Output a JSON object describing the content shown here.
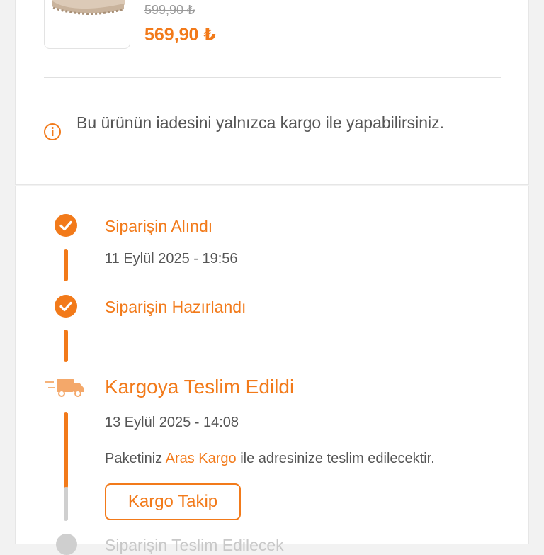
{
  "product": {
    "old_price": "599,90 ₺",
    "new_price": "569,90 ₺"
  },
  "return_notice": {
    "icon": "info-icon",
    "text": "Bu ürünün iadesini yalnızca kargo ile yapabilirsiniz."
  },
  "timeline": {
    "steps": [
      {
        "title": "Siparişin Alındı",
        "date": "11 Eylül 2025 - 19:56",
        "status": "done",
        "icon": "check-circle-icon"
      },
      {
        "title": "Siparişin Hazırlandı",
        "date": "",
        "status": "done",
        "icon": "check-circle-icon"
      },
      {
        "title": "Kargoya Teslim Edildi",
        "date": "13 Eylül 2025 - 14:08",
        "status": "current",
        "icon": "delivery-truck-icon"
      },
      {
        "title": "Siparişin Teslim Edilecek",
        "date": "",
        "status": "pending",
        "icon": "pending-circle-icon"
      }
    ],
    "note_prefix": "Paketiniz ",
    "note_carrier": "Aras Kargo",
    "note_suffix": " ile adresinize teslim edilecektir.",
    "track_button": "Kargo Takip"
  },
  "colors": {
    "accent": "#f27a1a",
    "pending": "#cfcfcf",
    "text": "#555555",
    "background": "#f2f2f2"
  }
}
